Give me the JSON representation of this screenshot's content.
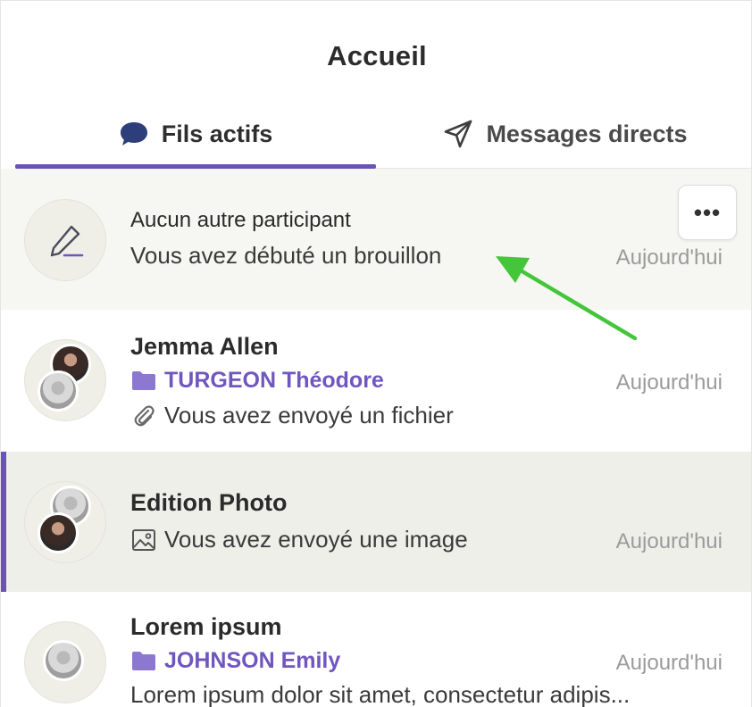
{
  "header": {
    "title": "Accueil"
  },
  "tabs": [
    {
      "label": "Fils actifs",
      "icon": "chat-bubble-icon",
      "active": true
    },
    {
      "label": "Messages directs",
      "icon": "send-icon",
      "active": false
    }
  ],
  "colors": {
    "accent": "#6b52b8",
    "folder": "#7056bf",
    "annotation_arrow": "#44c53a"
  },
  "threads": [
    {
      "title": "Aucun autre participant",
      "preview": "Vous avez débuté un brouillon",
      "date": "Aujourd'hui",
      "more_label": "•••",
      "avatar": "pencil-icon"
    },
    {
      "title": "Jemma Allen",
      "folder": "TURGEON Théodore",
      "preview": "Vous avez envoyé un fichier",
      "preview_icon": "paperclip-icon",
      "date": "Aujourd'hui"
    },
    {
      "title": "Edition Photo",
      "preview": "Vous avez envoyé une image",
      "preview_icon": "image-icon",
      "date": "Aujourd'hui",
      "selected": true
    },
    {
      "title": "Lorem ipsum",
      "folder": "JOHNSON Emily",
      "preview": "Lorem ipsum dolor sit amet, consectetur adipis...",
      "date": "Aujourd'hui"
    }
  ]
}
